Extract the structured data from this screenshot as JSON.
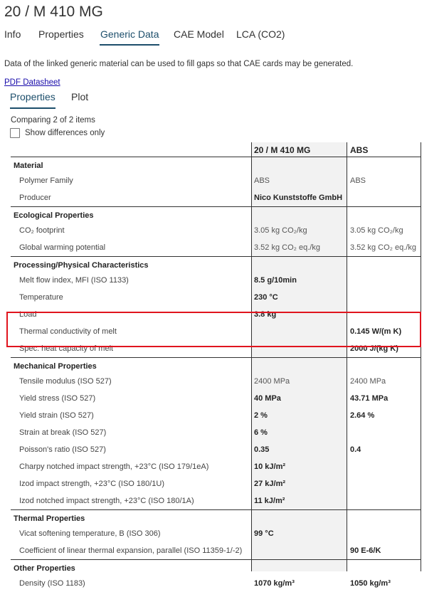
{
  "header": {
    "title": "20 / M 410 MG"
  },
  "main_tabs": [
    {
      "label": "Info",
      "active": false
    },
    {
      "label": "Properties",
      "active": false
    },
    {
      "label": "Generic Data",
      "active": true
    },
    {
      "label": "CAE Model",
      "active": false
    },
    {
      "label": "LCA (CO2)",
      "active": false
    }
  ],
  "description": "Data of the linked generic material can be used to fill gaps so that CAE cards may be generated.",
  "pdf_link": "PDF Datasheet",
  "sub_tabs": [
    {
      "label": "Properties",
      "active": true
    },
    {
      "label": "Plot",
      "active": false
    }
  ],
  "comparing": "Comparing 2 of 2 items",
  "show_differences": {
    "label": "Show differences only",
    "checked": false
  },
  "table": {
    "columns": [
      "",
      "20 / M 410 MG",
      "ABS"
    ],
    "groups": [
      {
        "name": "Material",
        "rows": [
          {
            "label": "Polymer Family",
            "v1": "ABS",
            "v1_bold": false,
            "v2": "ABS",
            "v2_bold": false
          },
          {
            "label": "Producer",
            "v1": "Nico Kunststoffe GmbH",
            "v1_bold": true,
            "v2": "",
            "v2_bold": false
          }
        ]
      },
      {
        "name": "Ecological Properties",
        "rows": [
          {
            "label": "CO₂ footprint",
            "v1": "3.05 kg CO₂/kg",
            "v1_bold": false,
            "v2": "3.05 kg CO₂/kg",
            "v2_bold": false
          },
          {
            "label": "Global warming potential",
            "v1": "3.52 kg CO₂ eq./kg",
            "v1_bold": false,
            "v2": "3.52 kg CO₂ eq./kg",
            "v2_bold": false
          }
        ]
      },
      {
        "name": "Processing/Physical Characteristics",
        "rows": [
          {
            "label": "Melt flow index, MFI (ISO 1133)",
            "v1": "8.5 g/10min",
            "v1_bold": true,
            "v2": "",
            "v2_bold": false
          },
          {
            "label": "Temperature",
            "v1": "230 °C",
            "v1_bold": true,
            "v2": "",
            "v2_bold": false
          },
          {
            "label": "Load",
            "v1": "3.8 kg",
            "v1_bold": true,
            "v2": "",
            "v2_bold": false
          },
          {
            "label": "Thermal conductivity of melt",
            "v1": "",
            "v1_bold": false,
            "v2": "0.145 W/(m K)",
            "v2_bold": true
          },
          {
            "label": "Spec. heat capacity of melt",
            "v1": "",
            "v1_bold": false,
            "v2": "2000 J/(kg K)",
            "v2_bold": true
          }
        ]
      },
      {
        "name": "Mechanical Properties",
        "rows": [
          {
            "label": "Tensile modulus (ISO 527)",
            "v1": "2400 MPa",
            "v1_bold": false,
            "v2": "2400 MPa",
            "v2_bold": false
          },
          {
            "label": "Yield stress (ISO 527)",
            "v1": "40 MPa",
            "v1_bold": true,
            "v2": "43.71 MPa",
            "v2_bold": true
          },
          {
            "label": "Yield strain (ISO 527)",
            "v1": "2 %",
            "v1_bold": true,
            "v2": "2.64 %",
            "v2_bold": true
          },
          {
            "label": "Strain at break (ISO 527)",
            "v1": "6 %",
            "v1_bold": true,
            "v2": "",
            "v2_bold": false
          },
          {
            "label": "Poisson's ratio (ISO 527)",
            "v1": "0.35",
            "v1_bold": true,
            "v2": "0.4",
            "v2_bold": true
          },
          {
            "label": "Charpy notched impact strength, +23°C (ISO 179/1eA)",
            "v1": "10 kJ/m²",
            "v1_bold": true,
            "v2": "",
            "v2_bold": false
          },
          {
            "label": "Izod impact strength, +23°C (ISO 180/1U)",
            "v1": "27 kJ/m²",
            "v1_bold": true,
            "v2": "",
            "v2_bold": false
          },
          {
            "label": "Izod notched impact strength, +23°C (ISO 180/1A)",
            "v1": "11 kJ/m²",
            "v1_bold": true,
            "v2": "",
            "v2_bold": false
          }
        ]
      },
      {
        "name": "Thermal Properties",
        "rows": [
          {
            "label": "Vicat softening temperature, B (ISO 306)",
            "v1": "99 °C",
            "v1_bold": true,
            "v2": "",
            "v2_bold": false
          },
          {
            "label": "Coefficient of linear thermal expansion, parallel (ISO 11359-1/-2)",
            "v1": "",
            "v1_bold": false,
            "v2": "90 E-6/K",
            "v2_bold": true
          }
        ]
      },
      {
        "name": "Other Properties",
        "rows": [
          {
            "label": "Density (ISO 1183)",
            "v1": "1070 kg/m³",
            "v1_bold": true,
            "v2": "1050 kg/m³",
            "v2_bold": true
          }
        ]
      }
    ]
  },
  "highlight": {
    "color": "#e0141e",
    "rows": [
      "Thermal conductivity of melt",
      "Spec. heat capacity of melt"
    ]
  },
  "colors": {
    "accent": "#1c4e6b",
    "link": "#1a0dab",
    "highlight": "#e0141e",
    "column_bg": "#f2f2f2"
  }
}
